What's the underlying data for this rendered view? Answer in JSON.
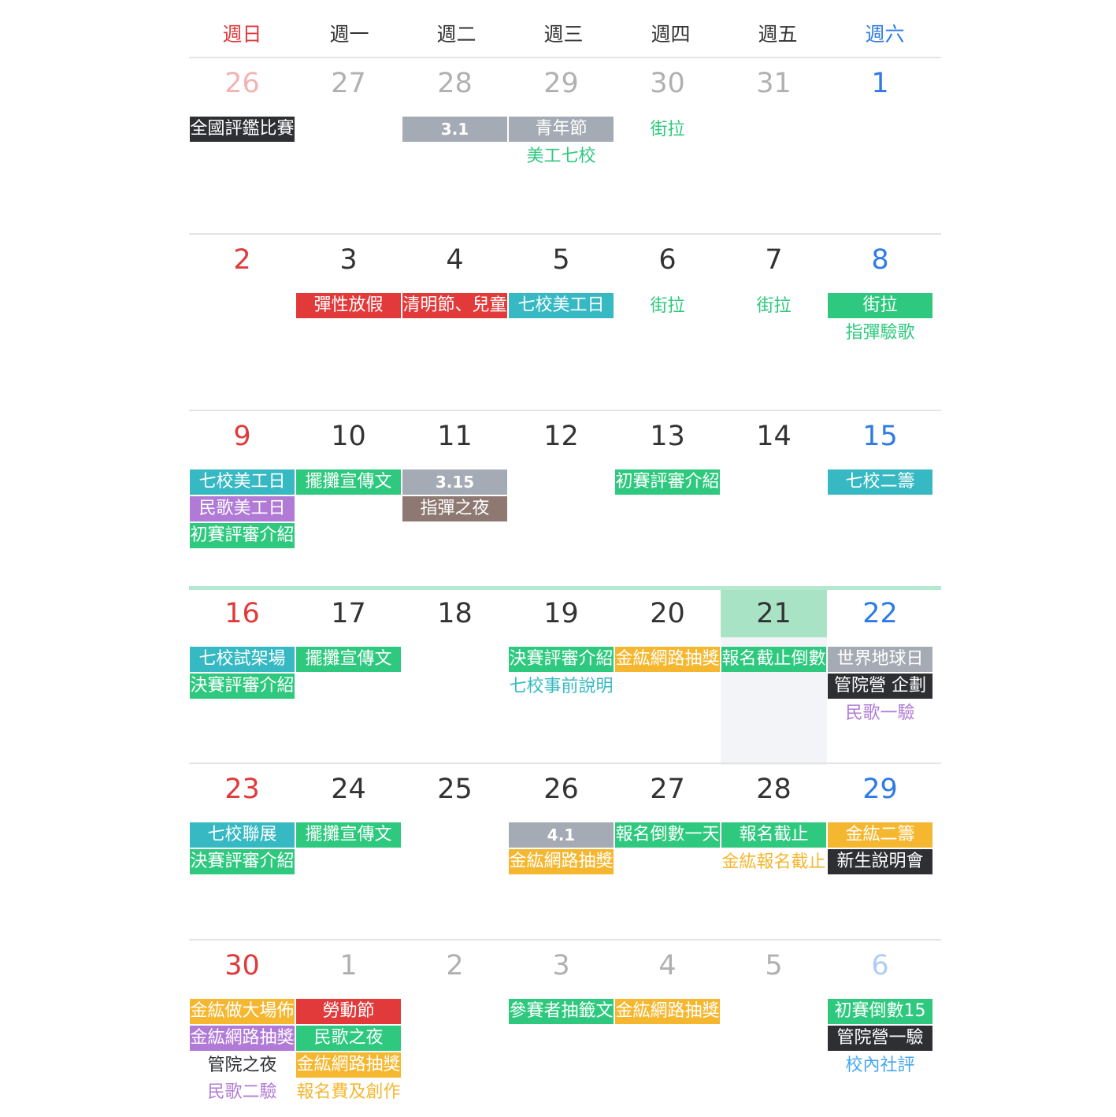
{
  "colors": {
    "sunday": "#e03a3a",
    "saturday": "#2f7be4",
    "text": "#333333",
    "today_header": "#a9e3c6",
    "today_bg": "#f2f4f7",
    "current_week_line": "#b4e8cf",
    "black": "#2d2f33",
    "gray": "#a5abb4",
    "green": "#2ec97e",
    "red": "#e23a3a",
    "teal": "#36b9c3",
    "purple": "#b07ad6",
    "brown": "#8d7872",
    "orange": "#f5b730",
    "blue": "#45a7f0"
  },
  "weekdays": [
    "週日",
    "週一",
    "週二",
    "週三",
    "週四",
    "週五",
    "週六"
  ],
  "weeks": [
    {
      "current": false,
      "days": [
        {
          "num": "26",
          "dim": true,
          "events": [
            {
              "text": "全國評鑑比賽",
              "color": "black",
              "filled": true
            }
          ]
        },
        {
          "num": "27",
          "dim": true,
          "events": []
        },
        {
          "num": "28",
          "dim": true,
          "events": [
            {
              "text": "3.1",
              "color": "gray",
              "filled": true,
              "numeric": true
            }
          ]
        },
        {
          "num": "29",
          "dim": true,
          "events": [
            {
              "text": "青年節",
              "color": "gray",
              "filled": true
            },
            {
              "text": "美工七校",
              "color": "green",
              "filled": false
            }
          ]
        },
        {
          "num": "30",
          "dim": true,
          "events": [
            {
              "text": "街拉",
              "color": "green",
              "filled": false
            }
          ]
        },
        {
          "num": "31",
          "dim": true,
          "events": []
        },
        {
          "num": "1",
          "dim": false,
          "events": []
        }
      ]
    },
    {
      "current": false,
      "days": [
        {
          "num": "2",
          "dim": false,
          "events": []
        },
        {
          "num": "3",
          "dim": false,
          "events": [
            {
              "text": "彈性放假",
              "color": "red",
              "filled": true
            }
          ]
        },
        {
          "num": "4",
          "dim": false,
          "events": [
            {
              "text": "清明節、兒童",
              "color": "red",
              "filled": true
            }
          ]
        },
        {
          "num": "5",
          "dim": false,
          "events": [
            {
              "text": "七校美工日",
              "color": "teal",
              "filled": true
            }
          ]
        },
        {
          "num": "6",
          "dim": false,
          "events": [
            {
              "text": "街拉",
              "color": "green",
              "filled": false
            }
          ]
        },
        {
          "num": "7",
          "dim": false,
          "events": [
            {
              "text": "街拉",
              "color": "green",
              "filled": false
            }
          ]
        },
        {
          "num": "8",
          "dim": false,
          "events": [
            {
              "text": "街拉",
              "color": "green",
              "filled": true
            },
            {
              "text": "指彈驗歌",
              "color": "green",
              "filled": false
            }
          ]
        }
      ]
    },
    {
      "current": false,
      "days": [
        {
          "num": "9",
          "dim": false,
          "events": [
            {
              "text": "七校美工日",
              "color": "teal",
              "filled": true
            },
            {
              "text": "民歌美工日",
              "color": "purple",
              "filled": true
            },
            {
              "text": "初賽評審介紹",
              "color": "green",
              "filled": true
            }
          ]
        },
        {
          "num": "10",
          "dim": false,
          "events": [
            {
              "text": "擺攤宣傳文",
              "color": "green",
              "filled": true
            }
          ]
        },
        {
          "num": "11",
          "dim": false,
          "events": [
            {
              "text": "3.15",
              "color": "gray",
              "filled": true,
              "numeric": true
            },
            {
              "text": "指彈之夜",
              "color": "brown",
              "filled": true
            }
          ]
        },
        {
          "num": "12",
          "dim": false,
          "events": []
        },
        {
          "num": "13",
          "dim": false,
          "events": [
            {
              "text": "初賽評審介紹",
              "color": "green",
              "filled": true
            }
          ]
        },
        {
          "num": "14",
          "dim": false,
          "events": []
        },
        {
          "num": "15",
          "dim": false,
          "events": [
            {
              "text": "七校二籌",
              "color": "teal",
              "filled": true
            }
          ]
        }
      ]
    },
    {
      "current": true,
      "days": [
        {
          "num": "16",
          "dim": false,
          "events": [
            {
              "text": "七校試架場",
              "color": "teal",
              "filled": true
            },
            {
              "text": "決賽評審介紹",
              "color": "green",
              "filled": true
            }
          ]
        },
        {
          "num": "17",
          "dim": false,
          "events": [
            {
              "text": "擺攤宣傳文",
              "color": "green",
              "filled": true
            }
          ]
        },
        {
          "num": "18",
          "dim": false,
          "events": []
        },
        {
          "num": "19",
          "dim": false,
          "events": [
            {
              "text": "決賽評審介紹",
              "color": "green",
              "filled": true
            },
            {
              "text": "七校事前說明",
              "color": "teal",
              "filled": false
            }
          ]
        },
        {
          "num": "20",
          "dim": false,
          "events": [
            {
              "text": "金紘網路抽獎",
              "color": "orange",
              "filled": true
            }
          ]
        },
        {
          "num": "21",
          "dim": false,
          "today": true,
          "events": [
            {
              "text": "報名截止倒數",
              "color": "green",
              "filled": true
            }
          ]
        },
        {
          "num": "22",
          "dim": false,
          "events": [
            {
              "text": "世界地球日",
              "color": "gray",
              "filled": true
            },
            {
              "text": "管院營 企劃",
              "color": "black",
              "filled": true
            },
            {
              "text": "民歌一驗",
              "color": "purple",
              "filled": false
            }
          ]
        }
      ]
    },
    {
      "current": false,
      "days": [
        {
          "num": "23",
          "dim": false,
          "events": [
            {
              "text": "七校聯展",
              "color": "teal",
              "filled": true
            },
            {
              "text": "決賽評審介紹",
              "color": "green",
              "filled": true
            }
          ]
        },
        {
          "num": "24",
          "dim": false,
          "events": [
            {
              "text": "擺攤宣傳文",
              "color": "green",
              "filled": true
            }
          ]
        },
        {
          "num": "25",
          "dim": false,
          "events": []
        },
        {
          "num": "26",
          "dim": false,
          "events": [
            {
              "text": "4.1",
              "color": "gray",
              "filled": true,
              "numeric": true
            },
            {
              "text": "金紘網路抽獎",
              "color": "orange",
              "filled": true
            }
          ]
        },
        {
          "num": "27",
          "dim": false,
          "events": [
            {
              "text": "報名倒數一天",
              "color": "green",
              "filled": true
            }
          ]
        },
        {
          "num": "28",
          "dim": false,
          "events": [
            {
              "text": "報名截止",
              "color": "green",
              "filled": true
            },
            {
              "text": "金紘報名截止",
              "color": "orange",
              "filled": false
            }
          ]
        },
        {
          "num": "29",
          "dim": false,
          "events": [
            {
              "text": "金紘二籌",
              "color": "orange",
              "filled": true
            },
            {
              "text": "新生說明會",
              "color": "black",
              "filled": true
            }
          ]
        }
      ]
    },
    {
      "current": false,
      "days": [
        {
          "num": "30",
          "dim": false,
          "events": [
            {
              "text": "金紘做大場佈",
              "color": "orange",
              "filled": true
            },
            {
              "text": "金紘網路抽獎",
              "color": "purple",
              "filled": true
            },
            {
              "text": "管院之夜",
              "color": "black",
              "filled": false
            },
            {
              "text": "民歌二驗",
              "color": "purple",
              "filled": false
            }
          ]
        },
        {
          "num": "1",
          "dim": true,
          "events": [
            {
              "text": "勞動節",
              "color": "red",
              "filled": true
            },
            {
              "text": "民歌之夜",
              "color": "green",
              "filled": true
            },
            {
              "text": "金紘網路抽獎",
              "color": "orange",
              "filled": true
            },
            {
              "text": "報名費及創作",
              "color": "orange",
              "filled": false
            }
          ]
        },
        {
          "num": "2",
          "dim": true,
          "events": []
        },
        {
          "num": "3",
          "dim": true,
          "events": [
            {
              "text": "參賽者抽籤文",
              "color": "green",
              "filled": true
            }
          ]
        },
        {
          "num": "4",
          "dim": true,
          "events": [
            {
              "text": "金紘網路抽獎",
              "color": "orange",
              "filled": true
            }
          ]
        },
        {
          "num": "5",
          "dim": true,
          "events": []
        },
        {
          "num": "6",
          "dim": true,
          "events": [
            {
              "text": "初賽倒數15",
              "color": "green",
              "filled": true
            },
            {
              "text": "管院營一驗",
              "color": "black",
              "filled": true
            },
            {
              "text": "校內社評",
              "color": "blue",
              "filled": false
            }
          ]
        }
      ]
    }
  ]
}
